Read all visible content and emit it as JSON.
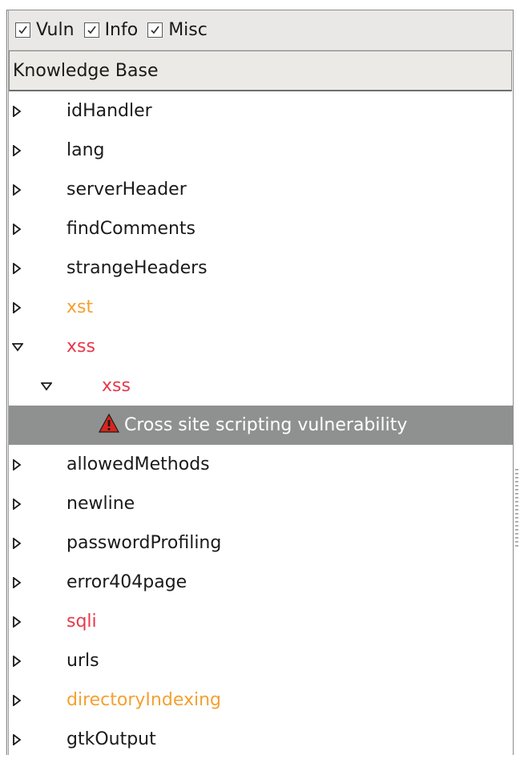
{
  "filters": [
    {
      "label": "Vuln",
      "checked": true
    },
    {
      "label": "Info",
      "checked": true
    },
    {
      "label": "Misc",
      "checked": true
    }
  ],
  "column_header": "Knowledge Base",
  "colors": {
    "default_text": "#1a1a1a",
    "info_orange": "#f5a030",
    "vuln_red": "#e8384a",
    "selected_bg": "#8f9190"
  },
  "tree": [
    {
      "label": "idHandler",
      "level": 0,
      "expanded": false,
      "color": "#1a1a1a"
    },
    {
      "label": "lang",
      "level": 0,
      "expanded": false,
      "color": "#1a1a1a"
    },
    {
      "label": "serverHeader",
      "level": 0,
      "expanded": false,
      "color": "#1a1a1a"
    },
    {
      "label": "findComments",
      "level": 0,
      "expanded": false,
      "color": "#1a1a1a"
    },
    {
      "label": "strangeHeaders",
      "level": 0,
      "expanded": false,
      "color": "#1a1a1a"
    },
    {
      "label": "xst",
      "level": 0,
      "expanded": false,
      "color": "#f5a030"
    },
    {
      "label": "xss",
      "level": 0,
      "expanded": true,
      "color": "#e8384a"
    },
    {
      "label": "xss",
      "level": 1,
      "expanded": true,
      "color": "#e8384a"
    },
    {
      "label": "Cross site scripting vulnerability",
      "level": 2,
      "leaf": true,
      "icon": "warning-icon",
      "selected": true,
      "color": "#ffffff"
    },
    {
      "label": "allowedMethods",
      "level": 0,
      "expanded": false,
      "color": "#1a1a1a"
    },
    {
      "label": "newline",
      "level": 0,
      "expanded": false,
      "color": "#1a1a1a"
    },
    {
      "label": "passwordProfiling",
      "level": 0,
      "expanded": false,
      "color": "#1a1a1a"
    },
    {
      "label": "error404page",
      "level": 0,
      "expanded": false,
      "color": "#1a1a1a"
    },
    {
      "label": "sqli",
      "level": 0,
      "expanded": false,
      "color": "#e8384a"
    },
    {
      "label": "urls",
      "level": 0,
      "expanded": false,
      "color": "#1a1a1a"
    },
    {
      "label": "directoryIndexing",
      "level": 0,
      "expanded": false,
      "color": "#f5a030"
    },
    {
      "label": "gtkOutput",
      "level": 0,
      "expanded": false,
      "color": "#1a1a1a"
    }
  ]
}
